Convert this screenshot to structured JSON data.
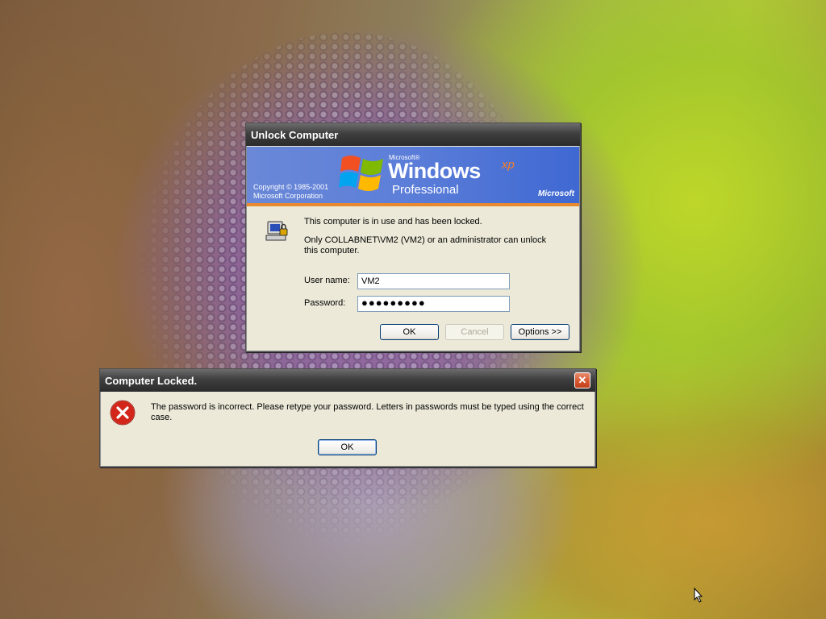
{
  "desktop": {
    "wallpaper_icon": "fish-wallpaper"
  },
  "unlock_dialog": {
    "title": "Unlock Computer",
    "banner": {
      "copyright_line1": "Copyright © 1985-2001",
      "copyright_line2": "Microsoft Corporation",
      "microsoft_small": "Microsoft®",
      "windows": "Windows",
      "xp": "xp",
      "edition": "Professional",
      "brand": "Microsoft"
    },
    "lock_icon": "locked-computer-icon",
    "message1": "This computer is in use and has been locked.",
    "message2": "Only COLLABNET\\VM2 (VM2) or an administrator can unlock this computer.",
    "username_label": "User name:",
    "username_value": "VM2",
    "password_label": "Password:",
    "password_value": "●●●●●●●●●",
    "ok_label": "OK",
    "cancel_label": "Cancel",
    "options_label": "Options >>"
  },
  "error_dialog": {
    "title": "Computer Locked.",
    "close_label": "✕",
    "icon": "error-icon",
    "message": "The password is incorrect.  Please retype your password.  Letters in passwords must be typed using the correct case.",
    "ok_label": "OK"
  },
  "colors": {
    "xp_banner_blue": "#5d7fd9",
    "xp_orange": "#e8892f",
    "error_red": "#d2261a"
  }
}
